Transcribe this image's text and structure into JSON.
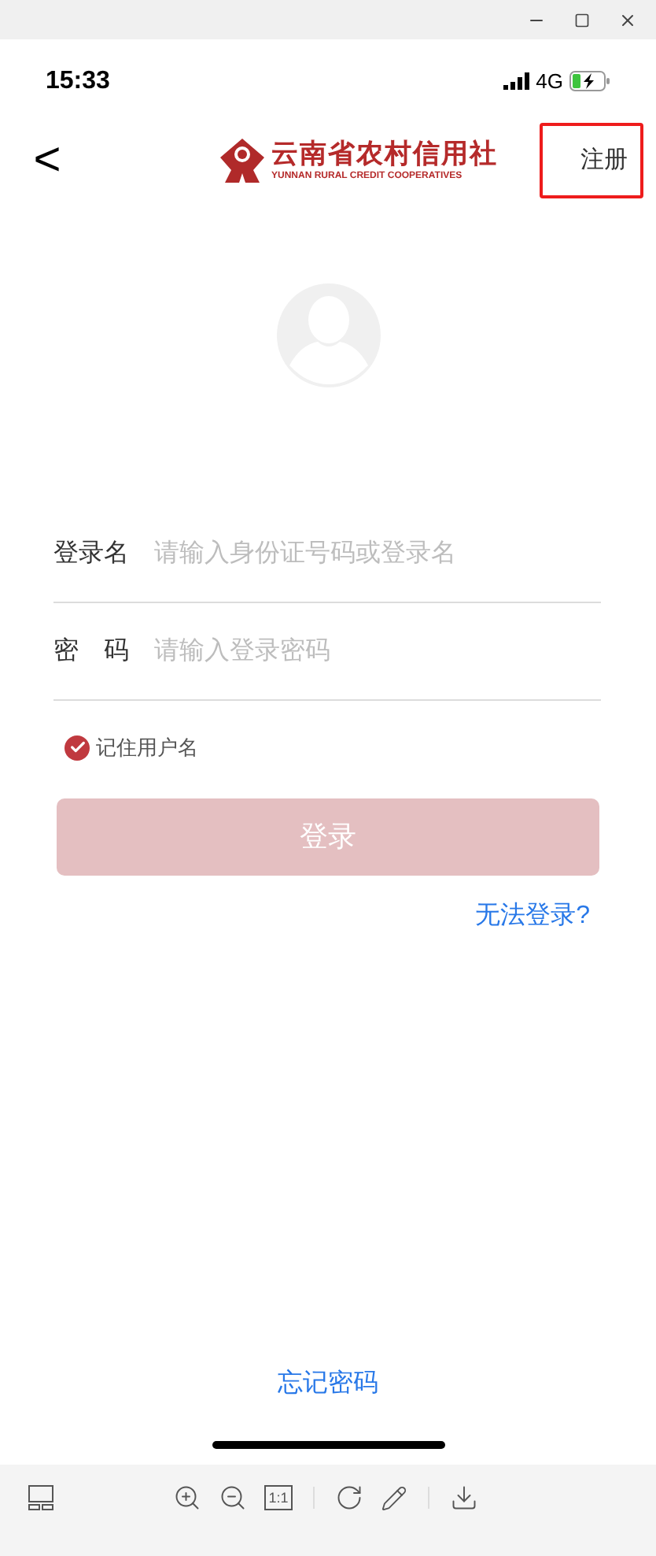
{
  "status_bar": {
    "time": "15:33",
    "network": "4G"
  },
  "nav": {
    "back": "<",
    "logo_title": "云南省农村信用社",
    "logo_subtitle": "YUNNAN RURAL CREDIT COOPERATIVES",
    "register": "注册",
    "register_highlighted": true
  },
  "fields": [
    {
      "label": "登录名",
      "placeholder": "请输入身份证号码或登录名"
    },
    {
      "label": "密　码",
      "placeholder": "请输入登录密码"
    }
  ],
  "remember": {
    "label": "记住用户名",
    "checked": true
  },
  "login_button": {
    "label": "登录",
    "disabled": true
  },
  "cannot_login": "无法登录?",
  "forgot_password": "忘记密码",
  "viewer_toolbar": {
    "actual_size": "1:1"
  }
}
